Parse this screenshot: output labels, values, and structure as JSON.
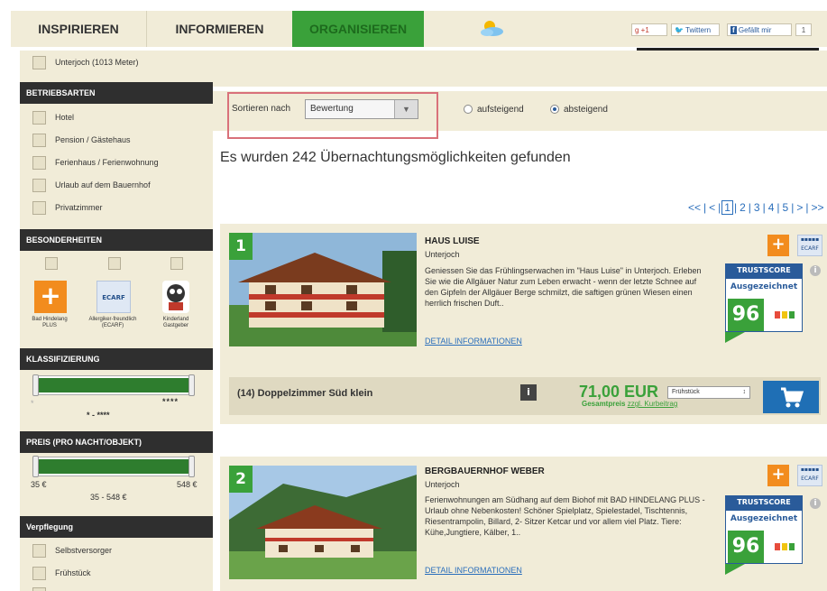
{
  "nav": {
    "tabs": [
      "INSPIRIEREN",
      "INFORMIEREN",
      "ORGANISIEREN"
    ],
    "social": {
      "gplus": "+1",
      "twitter": "Twittern",
      "facebook": "Gefällt mir",
      "count": "1"
    }
  },
  "sidebar": {
    "location_item": "Unterjoch (1013 Meter)",
    "sections": {
      "betriebsarten": "BETRIEBSARTEN",
      "besonderheiten": "BESONDERHEITEN",
      "klassifizierung": "KLASSIFIZIERUNG",
      "preis": "PREIS (PRO NACHT/OBJEKT)",
      "verpflegung": "Verpflegung"
    },
    "betriebsarten_items": [
      "Hotel",
      "Pension / Gästehaus",
      "Ferienhaus / Ferienwohnung",
      "Urlaub auf dem Bauernhof",
      "Privatzimmer"
    ],
    "badges": [
      {
        "label": "Bad Hindelang PLUS"
      },
      {
        "label": "Allergiker-freundlich (ECARF)",
        "logo_text": "ECARF"
      },
      {
        "label": "Kinderland Gastgeber"
      }
    ],
    "klass": {
      "min": "*",
      "max": "****",
      "range": "* - ****"
    },
    "price": {
      "min": "35 €",
      "max": "548 €",
      "range": "35 - 548 €"
    },
    "verpflegung_items": [
      "Selbstversorger",
      "Frühstück"
    ]
  },
  "sort": {
    "label": "Sortieren nach",
    "selected": "Bewertung",
    "asc": "aufsteigend",
    "desc": "absteigend",
    "desc_selected": true
  },
  "results_heading": "Es wurden 242 Übernachtungsmöglichkeiten gefunden",
  "pager": {
    "first": "<<",
    "prev": "<",
    "pages": [
      "1",
      "2",
      "3",
      "4",
      "5"
    ],
    "next": ">",
    "last": ">>",
    "current": "1"
  },
  "listings": [
    {
      "rank": "1",
      "title": "HAUS LUISE",
      "place": "Unterjoch",
      "desc": "Geniessen Sie das Frühlingserwachen im \"Haus Luise\" in Unterjoch. Erleben Sie wie die Allgäuer Natur zum Leben erwacht - wenn der letzte Schnee auf den Gipfeln der Allgäuer Berge schmilzt, die saftigen grünen Wiesen einen herrlich frischen Duft..",
      "link": "DETAIL INFORMATIONEN",
      "trust_label": "TRUSTSCORE",
      "trust_rating": "Ausgezeichnet",
      "trust_score": "96",
      "offer": {
        "name": "(14) Doppelzimmer Süd klein",
        "price": "71,00 EUR",
        "price_note_prefix": "Gesamtpreis",
        "price_note_link": "zzgl. Kurbeitrag",
        "board": "Frühstück"
      }
    },
    {
      "rank": "2",
      "title": "BERGBAUERNHOF WEBER",
      "place": "Unterjoch",
      "desc": "Ferienwohnungen am Südhang auf dem Biohof mit BAD HINDELANG PLUS - Urlaub ohne Nebenkosten! Schöner Spielplatz, Spielestadel, Tischtennis, Riesentrampolin, Billard, 2- Sitzer Ketcar und vor allem viel Platz. Tiere: Kühe,Jungtiere, Kälber, 1..",
      "link": "DETAIL INFORMATIONEN",
      "trust_label": "TRUSTSCORE",
      "trust_rating": "Ausgezeichnet",
      "trust_score": "96"
    }
  ]
}
